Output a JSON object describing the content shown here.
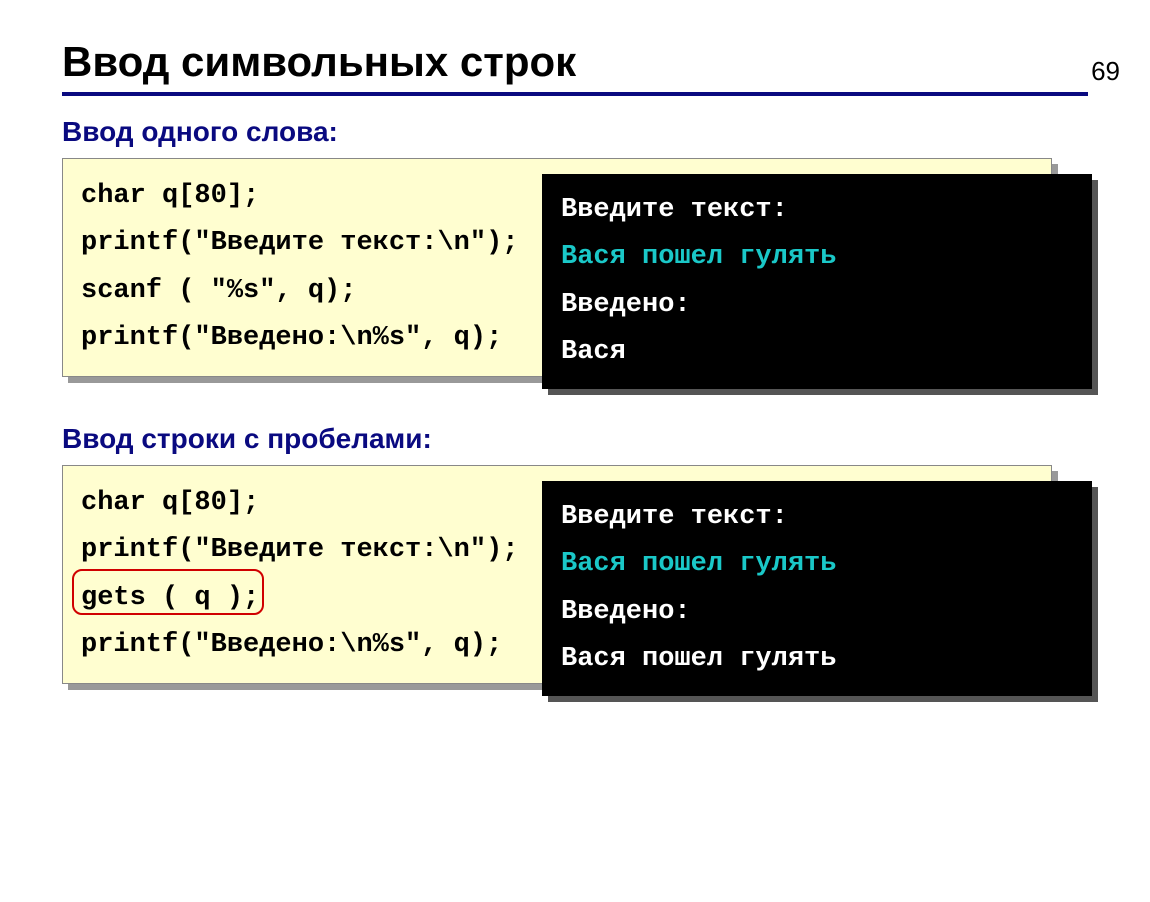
{
  "pageNumber": "69",
  "title": "Ввод символьных строк",
  "section1": {
    "label": "Ввод одного слова:",
    "code": "char q[80];\nprintf(\"Введите текст:\\n\");\nscanf ( \"%s\", q);\nprintf(\"Введено:\\n%s\", q);",
    "console": {
      "line1": "Введите текст:",
      "userInput": "Вася пошел гулять",
      "line3": "Введено:",
      "line4": "Вася"
    }
  },
  "section2": {
    "label": "Ввод строки с пробелами:",
    "code": "char q[80];\nprintf(\"Введите текст:\\n\");\ngets ( q );\nprintf(\"Введено:\\n%s\", q);",
    "highlightedPart": "gets ( q );",
    "console": {
      "line1": "Введите текст:",
      "userInput": "Вася пошел гулять",
      "line3": "Введено:",
      "line4": "Вася пошел гулять"
    }
  }
}
